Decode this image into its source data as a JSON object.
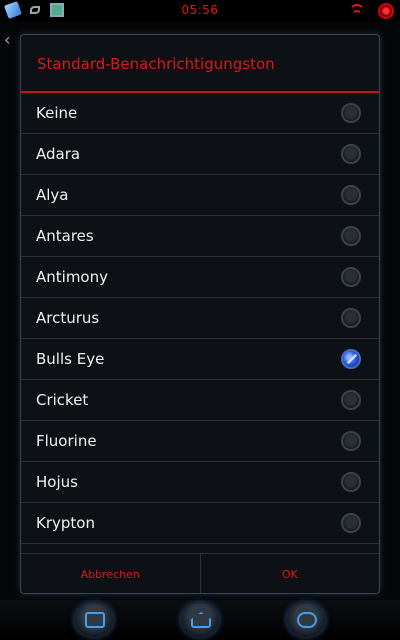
{
  "status_bar": {
    "time": "05:56",
    "icons": [
      "phone-icon",
      "leaf-icon",
      "picture-icon",
      "wifi-icon",
      "battery-icon"
    ],
    "accent_color": "#e01616"
  },
  "dialog": {
    "title": "Standard-Benachrichtigungston",
    "items": [
      {
        "label": "Keine",
        "checked": false
      },
      {
        "label": "Adara",
        "checked": false
      },
      {
        "label": "Alya",
        "checked": false
      },
      {
        "label": "Antares",
        "checked": false
      },
      {
        "label": "Antimony",
        "checked": false
      },
      {
        "label": "Arcturus",
        "checked": false
      },
      {
        "label": "Bulls Eye",
        "checked": true
      },
      {
        "label": "Cricket",
        "checked": false
      },
      {
        "label": "Fluorine",
        "checked": false
      },
      {
        "label": "Hojus",
        "checked": false
      },
      {
        "label": "Krypton",
        "checked": false
      }
    ],
    "cancel_label": "Abbrechen",
    "ok_label": "OK"
  },
  "nav_bar": {
    "buttons": [
      "recent-apps-icon",
      "home-icon",
      "back-icon"
    ]
  }
}
